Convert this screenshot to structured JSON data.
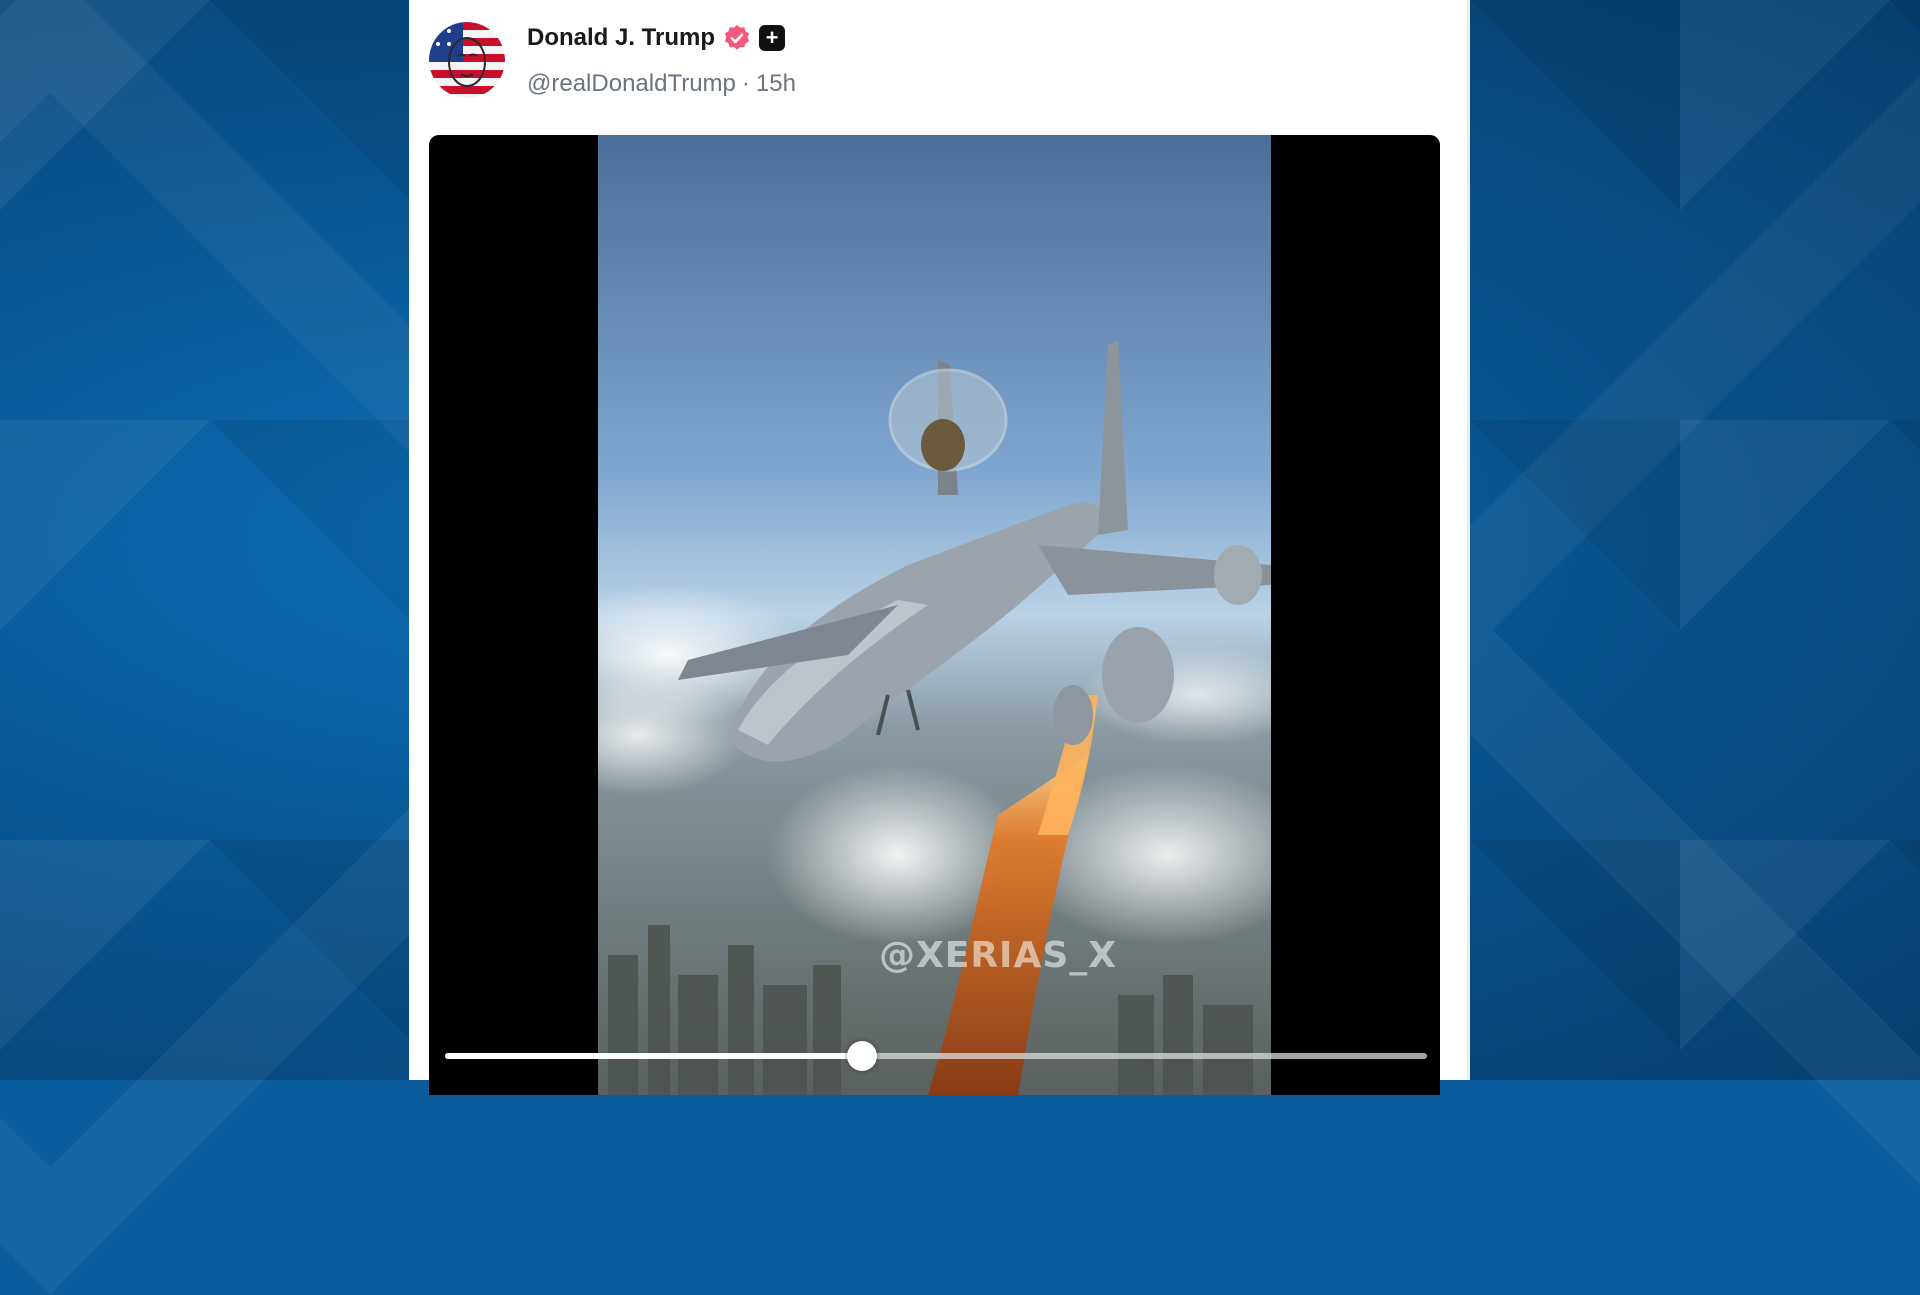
{
  "post": {
    "author": {
      "display_name": "Donald J. Trump",
      "handle": "@realDonaldTrump",
      "separator": "·",
      "time_ago": "15h",
      "verified_icon": "verified-badge-icon",
      "plus_icon": "plus-square-icon"
    },
    "video": {
      "watermark": "@XERIAS_X",
      "progress_percent": 42.5
    }
  },
  "colors": {
    "background": "#0a5c9c",
    "card": "#ffffff",
    "verified": "#f0587c",
    "text_primary": "#1a1a1a",
    "text_secondary": "#6b7280"
  }
}
